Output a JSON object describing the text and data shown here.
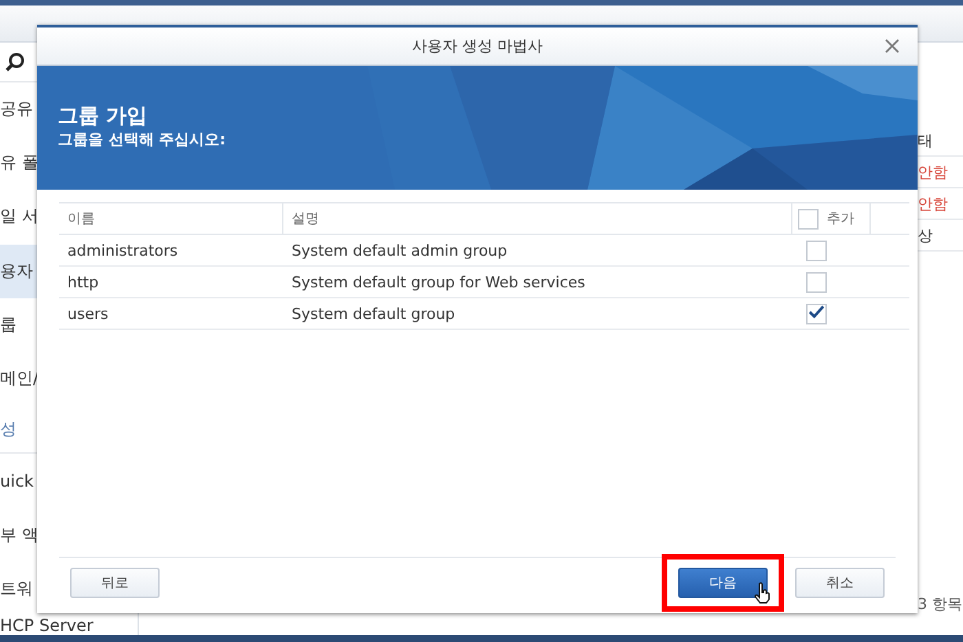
{
  "background_window": {
    "sidebar": {
      "items": [
        {
          "label": "공유",
          "kind": "item",
          "selected": false
        },
        {
          "label": "유 폴",
          "kind": "item",
          "selected": false
        },
        {
          "label": "일 서",
          "kind": "item",
          "selected": false
        },
        {
          "label": "용자",
          "kind": "item",
          "selected": true
        },
        {
          "label": "룹",
          "kind": "item",
          "selected": false
        },
        {
          "label": "메인/",
          "kind": "item",
          "selected": false
        },
        {
          "label": "성",
          "kind": "section",
          "selected": false
        },
        {
          "label": "uick",
          "kind": "item",
          "selected": false
        },
        {
          "label": "부 액",
          "kind": "item",
          "selected": false
        },
        {
          "label": "트워",
          "kind": "item",
          "selected": false
        },
        {
          "label": "HCP Server",
          "kind": "item",
          "selected": false
        }
      ]
    },
    "status_column": {
      "header": "태",
      "cells": [
        {
          "text": "안함",
          "kind": "alert"
        },
        {
          "text": "안함",
          "kind": "alert"
        },
        {
          "text": "상",
          "kind": "normal"
        }
      ]
    },
    "item_count": "3 항목"
  },
  "dialog": {
    "title": "사용자 생성 마법사",
    "heading": "그룹 가입",
    "subheading": "그룹을 선택해 주십시오:",
    "table": {
      "columns": [
        "이름",
        "설명"
      ],
      "select_all": {
        "label": "추가",
        "checked": false
      },
      "rows": [
        {
          "name": "administrators",
          "description": "System default admin group",
          "checked": false
        },
        {
          "name": "http",
          "description": "System default group for Web services",
          "checked": false
        },
        {
          "name": "users",
          "description": "System default group",
          "checked": true
        }
      ]
    },
    "buttons": [
      {
        "label": "뒤로",
        "kind": "secondary",
        "highlighted": false
      },
      {
        "label": "다음",
        "kind": "primary",
        "highlighted": true
      },
      {
        "label": "취소",
        "kind": "secondary",
        "highlighted": false
      }
    ]
  }
}
